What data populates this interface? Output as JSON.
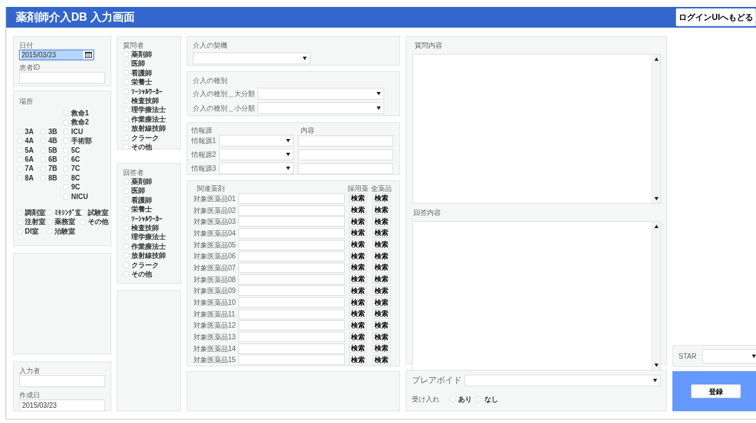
{
  "header": {
    "title": "薬剤師介入DB  入力画面",
    "back_button": "ログインUIへもどる"
  },
  "basic": {
    "date_label": "日付",
    "date_value": "2015/03/23",
    "patient_id_label": "患者ID"
  },
  "place": {
    "label": "場所",
    "columns": [
      {
        "options": [
          {
            "label": "3A",
            "selected": false
          },
          {
            "label": "4A",
            "selected": false
          },
          {
            "label": "5A",
            "selected": false
          },
          {
            "label": "6A",
            "selected": false
          },
          {
            "label": "7A",
            "selected": false
          },
          {
            "label": "8A",
            "selected": false
          }
        ]
      },
      {
        "options": [
          {
            "label": "3B",
            "selected": false
          },
          {
            "label": "4B",
            "selected": false
          },
          {
            "label": "5B",
            "selected": false
          },
          {
            "label": "6B",
            "selected": false
          },
          {
            "label": "7B",
            "selected": false
          },
          {
            "label": "8B",
            "selected": false
          }
        ]
      },
      {
        "options": [
          {
            "label": "救命1",
            "selected": false
          },
          {
            "label": "救命2",
            "selected": false
          },
          {
            "label": "ICU",
            "selected": false
          },
          {
            "label": "手術部",
            "selected": false
          },
          {
            "label": "5C",
            "selected": false
          },
          {
            "label": "6C",
            "selected": false
          },
          {
            "label": "7C",
            "selected": false
          },
          {
            "label": "8C",
            "selected": false
          },
          {
            "label": "9C",
            "selected": false
          },
          {
            "label": "NICU",
            "selected": false
          }
        ]
      }
    ],
    "rooms": [
      {
        "label": "調剤室",
        "selected": false
      },
      {
        "label": "ﾐｷｼﾝｸﾞ室",
        "selected": false
      },
      {
        "label": "試験室",
        "selected": false
      },
      {
        "label": "注射室",
        "selected": false
      },
      {
        "label": "薬務室",
        "selected": false
      },
      {
        "label": "その他",
        "selected": false
      },
      {
        "label": "DI室",
        "selected": false
      },
      {
        "label": "治験室",
        "selected": false
      }
    ]
  },
  "entry": {
    "author_label": "入力者",
    "created_label": "作成日",
    "created_value": "2015/03/23"
  },
  "questioner": {
    "label": "質問者",
    "options": [
      {
        "label": "薬剤師",
        "selected": false
      },
      {
        "label": "医師",
        "selected": false
      },
      {
        "label": "看護師",
        "selected": false
      },
      {
        "label": "栄養士",
        "selected": false
      },
      {
        "label": "ｿｰｼｬﾙﾜｰｶｰ",
        "selected": false
      },
      {
        "label": "検査技師",
        "selected": false
      },
      {
        "label": "理学療法士",
        "selected": false
      },
      {
        "label": "作業療法士",
        "selected": false
      },
      {
        "label": "放射線技師",
        "selected": false
      },
      {
        "label": "クラーク",
        "selected": false
      },
      {
        "label": "その他",
        "selected": false
      }
    ]
  },
  "answerer": {
    "label": "回答者",
    "options": [
      {
        "label": "薬剤師",
        "selected": false
      },
      {
        "label": "医師",
        "selected": false
      },
      {
        "label": "看護師",
        "selected": false
      },
      {
        "label": "栄養士",
        "selected": false
      },
      {
        "label": "ｿｰｼｬﾙﾜｰｶｰ",
        "selected": false
      },
      {
        "label": "検査技師",
        "selected": false
      },
      {
        "label": "理学療法士",
        "selected": false
      },
      {
        "label": "作業療法士",
        "selected": false
      },
      {
        "label": "放射線技師",
        "selected": false
      },
      {
        "label": "クラーク",
        "selected": false
      },
      {
        "label": "その他",
        "selected": false
      }
    ]
  },
  "trigger": {
    "label": "介入の契機"
  },
  "type": {
    "label": "介入の種別",
    "fields": [
      {
        "label": "介入の種別＿大分類"
      },
      {
        "label": "介入の種別＿小分類"
      }
    ]
  },
  "sources": {
    "label": "情報源",
    "content_label": "内容",
    "rows": [
      {
        "label": "情報源1"
      },
      {
        "label": "情報源2"
      },
      {
        "label": "情報源3"
      }
    ]
  },
  "drugs": {
    "label": "関連薬剤",
    "adopted_label": "採用薬",
    "all_label": "全薬品",
    "rows": [
      {
        "label": "対象医薬品01",
        "adopted_button": "検索",
        "all_button": "検索"
      },
      {
        "label": "対象医薬品02",
        "adopted_button": "検索",
        "all_button": "検索"
      },
      {
        "label": "対象医薬品03",
        "adopted_button": "検索",
        "all_button": "検索"
      },
      {
        "label": "対象医薬品04",
        "adopted_button": "検索",
        "all_button": "検索"
      },
      {
        "label": "対象医薬品05",
        "adopted_button": "検索",
        "all_button": "検索"
      },
      {
        "label": "対象医薬品06",
        "adopted_button": "検索",
        "all_button": "検索"
      },
      {
        "label": "対象医薬品07",
        "adopted_button": "検索",
        "all_button": "検索"
      },
      {
        "label": "対象医薬品08",
        "adopted_button": "検索",
        "all_button": "検索"
      },
      {
        "label": "対象医薬品09",
        "adopted_button": "検索",
        "all_button": "検索"
      },
      {
        "label": "対象医薬品10",
        "adopted_button": "検索",
        "all_button": "検索"
      },
      {
        "label": "対象医薬品11",
        "adopted_button": "検索",
        "all_button": "検索"
      },
      {
        "label": "対象医薬品12",
        "adopted_button": "検索",
        "all_button": "検索"
      },
      {
        "label": "対象医薬品13",
        "adopted_button": "検索",
        "all_button": "検索"
      },
      {
        "label": "対象医薬品14",
        "adopted_button": "検索",
        "all_button": "検索"
      },
      {
        "label": "対象医薬品15",
        "adopted_button": "検索",
        "all_button": "検索"
      }
    ]
  },
  "content": {
    "question_label": "質問内容",
    "answer_label": "回答内容"
  },
  "outcome": {
    "avoid_label": "プレアボイド",
    "accept_label": "受け入れ",
    "accept_options": [
      {
        "label": "あり",
        "selected": false
      },
      {
        "label": "なし",
        "selected": false
      }
    ]
  },
  "star": {
    "label": "STAR"
  },
  "register_button": "登録"
}
